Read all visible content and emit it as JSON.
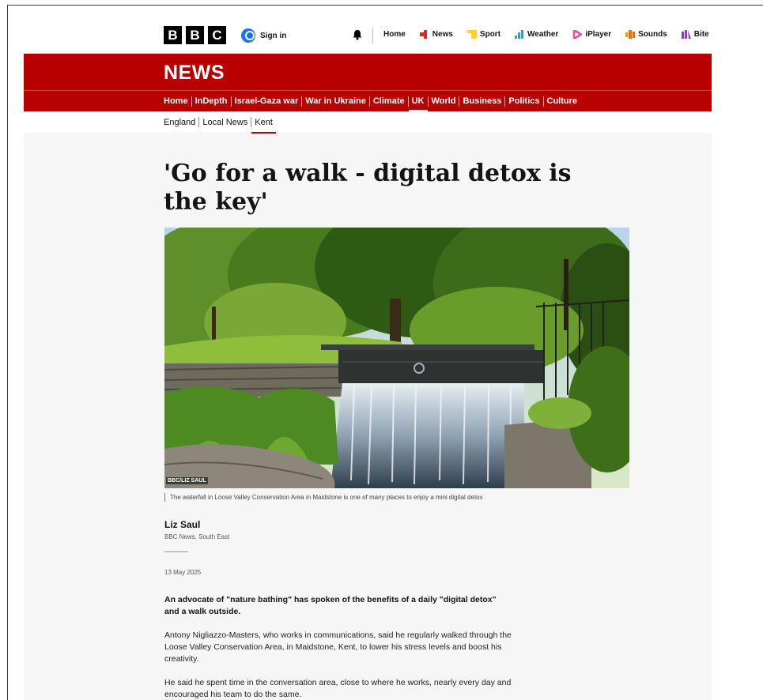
{
  "header": {
    "logo_letters": [
      "B",
      "B",
      "C"
    ],
    "sign_in": "Sign in",
    "nav": [
      {
        "label": "Home",
        "icon": "none",
        "color": "#000000"
      },
      {
        "label": "News",
        "icon": "news-icon",
        "color": "#e4251b"
      },
      {
        "label": "Sport",
        "icon": "sport-icon",
        "color": "#ffd230"
      },
      {
        "label": "Weather",
        "icon": "weather-icon",
        "color": "#2a9fd6"
      },
      {
        "label": "iPlayer",
        "icon": "iplayer-icon",
        "color": "#f54996"
      },
      {
        "label": "Sounds",
        "icon": "sounds-icon",
        "color": "#ff6600"
      },
      {
        "label": "Bite",
        "icon": "bitesize-icon",
        "color": "#8a3ebf"
      }
    ]
  },
  "news_bar": {
    "title": "NEWS",
    "color": "#b80000",
    "sections": [
      "Home",
      "InDepth",
      "Israel-Gaza war",
      "War in Ukraine",
      "Climate",
      "UK",
      "World",
      "Business",
      "Politics",
      "Culture"
    ],
    "active_section": "UK"
  },
  "subnav": {
    "items": [
      "England",
      "Local News",
      "Kent"
    ],
    "active": "Kent"
  },
  "article": {
    "headline": "'Go for a walk - digital detox is the key'",
    "image_credit": "BBC/LIZ SAUL",
    "caption": "The waterfall in Loose Valley Conservation Area in Maidstone is one of many places to enjoy a mini digital detox",
    "author": "Liz Saul",
    "author_role": "BBC News, South East",
    "date": "13 May 2025",
    "lead": "An advocate of \"nature bathing\" has spoken of the benefits of a daily \"digital detox\" and a walk outside.",
    "paragraphs": [
      "Antony Nigliazzo-Masters, who works in communications, said he regularly walked through the Loose Valley Conservation Area, in Maidstone, Kent, to lower his stress levels and boost his creativity.",
      "He said he spent time in the conversation area, close to where he works, nearly every day and encouraged his team to do the same."
    ]
  }
}
